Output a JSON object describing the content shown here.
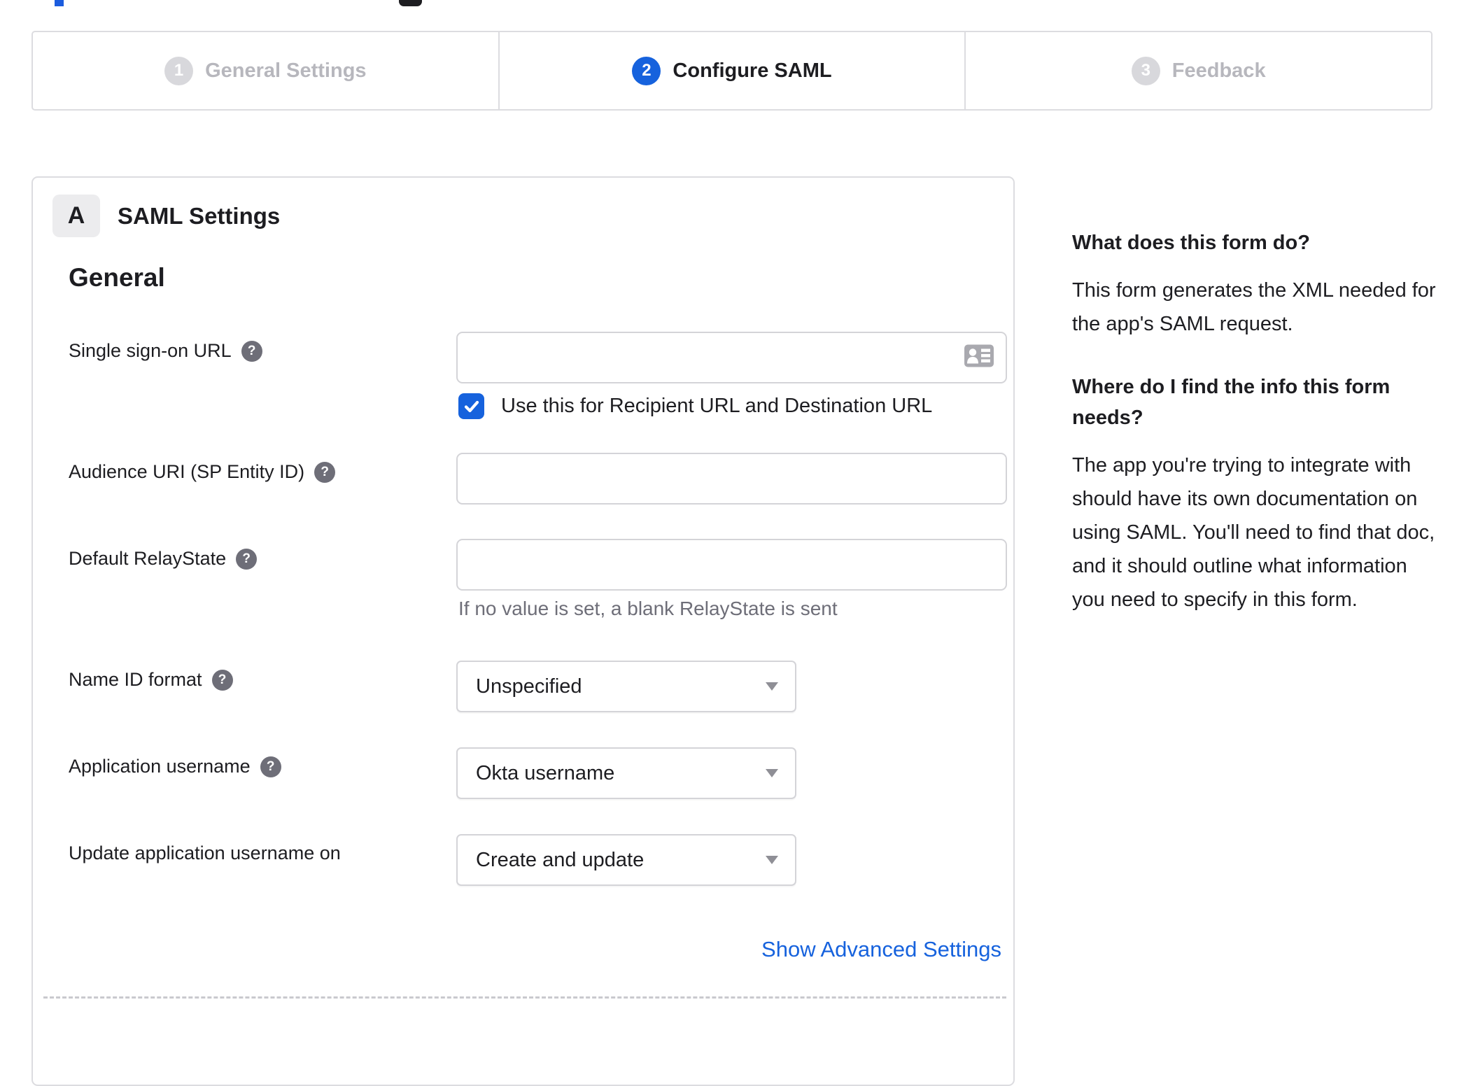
{
  "artifacts": {
    "top_blue_fragment": "cut-off blue element",
    "top_dark_fragment": "cut-off dark element"
  },
  "stepper": {
    "steps": [
      {
        "number": "1",
        "label": "General Settings",
        "state": "inactive"
      },
      {
        "number": "2",
        "label": "Configure SAML",
        "state": "active"
      },
      {
        "number": "3",
        "label": "Feedback",
        "state": "inactive"
      }
    ]
  },
  "panel": {
    "section_badge": "A",
    "section_title": "SAML Settings",
    "group_heading": "General",
    "fields": [
      {
        "label": "Single sign-on URL",
        "type": "text",
        "value": "",
        "icon": "contact-card-icon",
        "checkbox": {
          "checked": true,
          "label": "Use this for Recipient URL and Destination URL"
        }
      },
      {
        "label": "Audience URI (SP Entity ID)",
        "type": "text",
        "value": ""
      },
      {
        "label": "Default RelayState",
        "type": "text",
        "value": "",
        "helper": "If no value is set, a blank RelayState is sent"
      },
      {
        "label": "Name ID format",
        "type": "select",
        "value": "Unspecified"
      },
      {
        "label": "Application username",
        "type": "select",
        "value": "Okta username"
      },
      {
        "label": "Update application username on",
        "type": "select",
        "value": "Create and update"
      }
    ],
    "show_advanced_label": "Show Advanced Settings"
  },
  "help": {
    "q1": "What does this form do?",
    "a1": "This form generates the XML needed for the app's SAML request.",
    "q2": "Where do I find the info this form needs?",
    "a2": "The app you're trying to integrate with should have its own documentation on using SAML. You'll need to find that doc, and it should outline what information you need to specify in this form."
  },
  "colors": {
    "accent_blue": "#1662dd",
    "border_gray": "#dcdce0",
    "text_dark": "#1d1d21",
    "muted_gray": "#6e6e78",
    "step_inactive": "#d8d8dc",
    "step_label_inactive": "#b7b7bd"
  }
}
